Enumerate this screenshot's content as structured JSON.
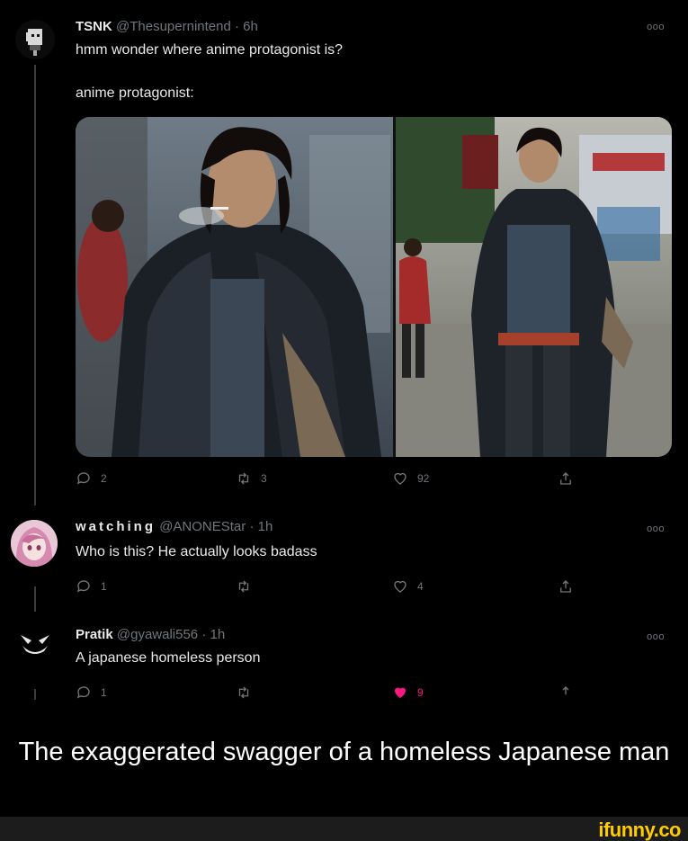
{
  "tweet1": {
    "name": "TSNK",
    "handle": "@Thesupernintend",
    "time": "6h",
    "text": "hmm wonder where anime protagonist is?",
    "text2": "anime protagonist:",
    "replies": "2",
    "retweets": "3",
    "likes": "92"
  },
  "tweet2": {
    "name": "watching",
    "handle": "@ANONEStar",
    "time": "1h",
    "text": "Who is this? He actually looks badass",
    "replies": "1",
    "retweets": "",
    "likes": "4"
  },
  "tweet3": {
    "name": "Pratik",
    "handle": "@gyawali556",
    "time": "1h",
    "text": "A japanese homeless person",
    "replies": "1",
    "retweets": "",
    "likes": "9"
  },
  "more_glyph": "ooo",
  "caption": "The exaggerated swagger of a homeless Japanese man",
  "watermark": "ifunny.co",
  "colors": {
    "background": "#000000",
    "text": "#e7e9ea",
    "muted": "#71767b",
    "like_active": "#f91880",
    "watermark": "#ffcc00"
  }
}
